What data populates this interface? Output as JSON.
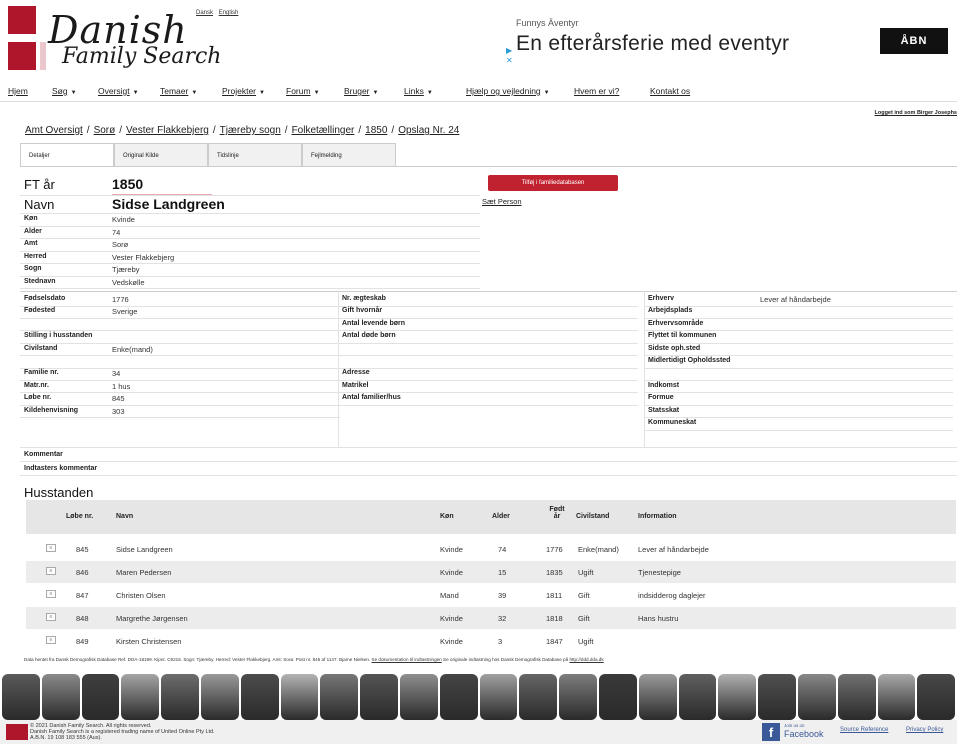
{
  "header": {
    "logo_line1": "Danish",
    "logo_line2": "Family Search",
    "lang_dansk": "Dansk",
    "lang_english": "English"
  },
  "ad": {
    "small": "Funnys Äventyr",
    "big": "En efterårsferie med eventyr",
    "button": "ÅBN"
  },
  "nav": [
    {
      "label": "Hjem",
      "caret": false
    },
    {
      "label": "Søg",
      "caret": true
    },
    {
      "label": "Oversigt",
      "caret": true
    },
    {
      "label": "Temaer",
      "caret": true
    },
    {
      "label": "Projekter",
      "caret": true
    },
    {
      "label": "Forum",
      "caret": true
    },
    {
      "label": "Bruger",
      "caret": true
    },
    {
      "label": "Links",
      "caret": true
    },
    {
      "label": "Hjælp og vejledning",
      "caret": true
    },
    {
      "label": "Hvem er vi?",
      "caret": false
    },
    {
      "label": "Kontakt os",
      "caret": false
    }
  ],
  "logged_in": "Logget ind som Birger Josephs",
  "breadcrumb": [
    "Amt Oversigt",
    "Sorø",
    "Vester Flakkebjerg",
    "Tjæreby sogn",
    "Folketællinger",
    "1850",
    "Opslag Nr. 24"
  ],
  "tabs": [
    "Detaljer",
    "Original Kilde",
    "Tidslinje",
    "Fejlmelding"
  ],
  "person": {
    "ft_label": "FT år",
    "ft_value": "1850",
    "name_label": "Navn",
    "name_value": "Sidse Landgreen",
    "add_button": "Tilføj i familiedatabasen",
    "set_person": "Sæt Person",
    "basic": [
      {
        "label": "Køn",
        "value": "Kvinde"
      },
      {
        "label": "Alder",
        "value": "74"
      },
      {
        "label": "Amt",
        "value": "Sorø"
      },
      {
        "label": "Herred",
        "value": "Vester Flakkebjerg"
      },
      {
        "label": "Sogn",
        "value": "Tjæreby"
      },
      {
        "label": "Stednavn",
        "value": "Vedskølle"
      }
    ],
    "col1": [
      {
        "label": "Fødselsdato",
        "value": "1776"
      },
      {
        "label": "Fødested",
        "value": "Sverige"
      },
      {
        "label": "",
        "value": ""
      },
      {
        "label": "Stilling i husstanden",
        "value": ""
      },
      {
        "label": "Civilstand",
        "value": "Enke(mand)"
      },
      {
        "label": "",
        "value": ""
      },
      {
        "label": "Familie nr.",
        "value": "34"
      },
      {
        "label": "Matr.nr.",
        "value": "1 hus"
      },
      {
        "label": "Løbe nr.",
        "value": "845"
      },
      {
        "label": "Kildehenvisning",
        "value": "303"
      }
    ],
    "col2": [
      {
        "label": "Nr. ægteskab",
        "value": ""
      },
      {
        "label": "Gift hvornår",
        "value": ""
      },
      {
        "label": "Antal levende børn",
        "value": ""
      },
      {
        "label": "Antal døde børn",
        "value": ""
      },
      {
        "label": "",
        "value": ""
      },
      {
        "label": "",
        "value": ""
      },
      {
        "label": "Adresse",
        "value": ""
      },
      {
        "label": "Matrikel",
        "value": ""
      },
      {
        "label": "Antal familier/hus",
        "value": ""
      }
    ],
    "col3": [
      {
        "label": "Erhverv",
        "value": "Lever af håndarbejde"
      },
      {
        "label": "Arbejdsplads",
        "value": ""
      },
      {
        "label": "Erhvervsområde",
        "value": ""
      },
      {
        "label": "Flyttet til kommunen",
        "value": ""
      },
      {
        "label": "Sidste oph.sted",
        "value": ""
      },
      {
        "label": "Midlertidigt Opholdssted",
        "value": ""
      },
      {
        "label": "",
        "value": ""
      },
      {
        "label": "Indkomst",
        "value": ""
      },
      {
        "label": "Formue",
        "value": ""
      },
      {
        "label": "Statsskat",
        "value": ""
      },
      {
        "label": "Kommuneskat",
        "value": ""
      }
    ],
    "kommentar": "Kommentar",
    "indtasters": "Indtasters kommentar"
  },
  "household": {
    "title": "Husstanden",
    "headers": [
      "Løbe nr.",
      "Navn",
      "Køn",
      "Alder",
      "Født år",
      "Civilstand",
      "Information"
    ],
    "rows": [
      {
        "nr": "845",
        "navn": "Sidse Landgreen",
        "kon": "Kvinde",
        "alder": "74",
        "fodt": "1776",
        "civil": "Enke(mand)",
        "info": "Lever af håndarbejde"
      },
      {
        "nr": "846",
        "navn": "Maren Pedersen",
        "kon": "Kvinde",
        "alder": "15",
        "fodt": "1835",
        "civil": "Ugift",
        "info": "Tjenestepige"
      },
      {
        "nr": "847",
        "navn": "Christen Olsen",
        "kon": "Mand",
        "alder": "39",
        "fodt": "1811",
        "civil": "Gift",
        "info": "indsidderog daglejer"
      },
      {
        "nr": "848",
        "navn": "Margrethe Jørgensen",
        "kon": "Kvinde",
        "alder": "32",
        "fodt": "1818",
        "civil": "Gift",
        "info": "Hans hustru"
      },
      {
        "nr": "849",
        "navn": "Kirsten Christensen",
        "kon": "Kvinde",
        "alder": "3",
        "fodt": "1847",
        "civil": "Ugift",
        "info": ""
      }
    ]
  },
  "source_text": "Data hentet fra Dansk Demografisk Database Ref. DDA-18199. Kipnr. C9215. Sogn: Tjæreby. Herred: Vester Flakkebjerg. Amt: Sorø. Post nr. 845 af 1147. Bjarne Nielsen.",
  "source_link1": "Se dokumentation til indtastningen",
  "source_mid": "Se originale indtastning hos Dansk Demografisk Database på",
  "source_link2": "http://ddd.dda.dk",
  "footer": {
    "copy1": "© 2021 Danish Family Search. All rights reserved.",
    "copy2": "Danish Family Search is a registered trading name of United Online Pty Ltd.",
    "copy3": "A.B.N. 19 108 183 555 (Aus).",
    "fb_small": "Join us on",
    "fb_big": "Facebook",
    "source_ref": "Source Reference",
    "privacy": "Privacy Policy"
  },
  "colors": {
    "accent": "#b0162b",
    "button": "#c0222f",
    "facebook": "#3b5998"
  }
}
